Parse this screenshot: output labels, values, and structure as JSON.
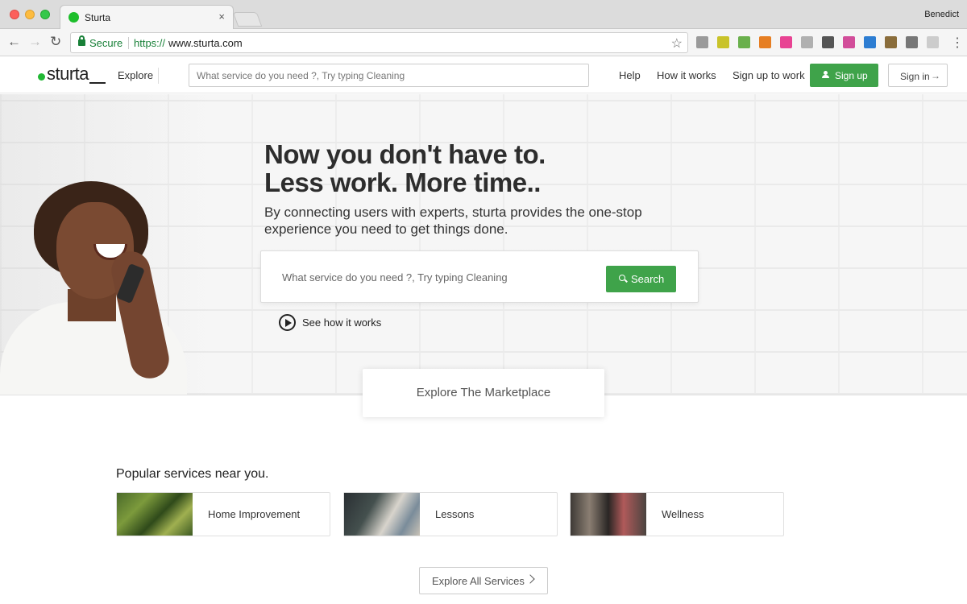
{
  "browser": {
    "tab_title": "Sturta",
    "tab_close": "×",
    "profile_name": "Benedict",
    "secure_label": "Secure",
    "url_scheme": "https://",
    "url_host": "www.sturta.com",
    "nav_back": "←",
    "nav_forward": "→",
    "nav_reload": "↻",
    "star": "☆",
    "menu": "⋮",
    "extension_colors": [
      "#9a9a9a",
      "#c9c32a",
      "#6ab04c",
      "#e67e22",
      "#e84393",
      "#b0b0b0",
      "#555555",
      "#d24d9a",
      "#2d7dd2",
      "#8a6d3b",
      "#777777",
      "#cccccc"
    ]
  },
  "header": {
    "logo_text": "sturta",
    "explore": "Explore",
    "search_placeholder": "What service do you need ?, Try typing Cleaning",
    "help": "Help",
    "how_it_works": "How it works",
    "sign_up_to_work": "Sign up to work",
    "sign_up": "Sign up",
    "sign_in": "Sign in",
    "sign_in_arrow": "→"
  },
  "hero": {
    "title_line1": "Now you don't have to.",
    "title_line2": "Less work. More time..",
    "subtitle": "By connecting users with experts, sturta provides the one-stop experience you need to get things done.",
    "search_placeholder": "What service do you need ?, Try typing Cleaning",
    "search_button": "Search",
    "see_how": "See how it works"
  },
  "marketplace": {
    "label": "Explore The Marketplace"
  },
  "popular": {
    "title": "Popular services near you.",
    "services": [
      {
        "label": "Home Improvement"
      },
      {
        "label": "Lessons"
      },
      {
        "label": "Wellness"
      }
    ],
    "explore_all": "Explore All Services"
  },
  "colors": {
    "brand_green": "#3fa34a",
    "secure_green": "#188038"
  }
}
